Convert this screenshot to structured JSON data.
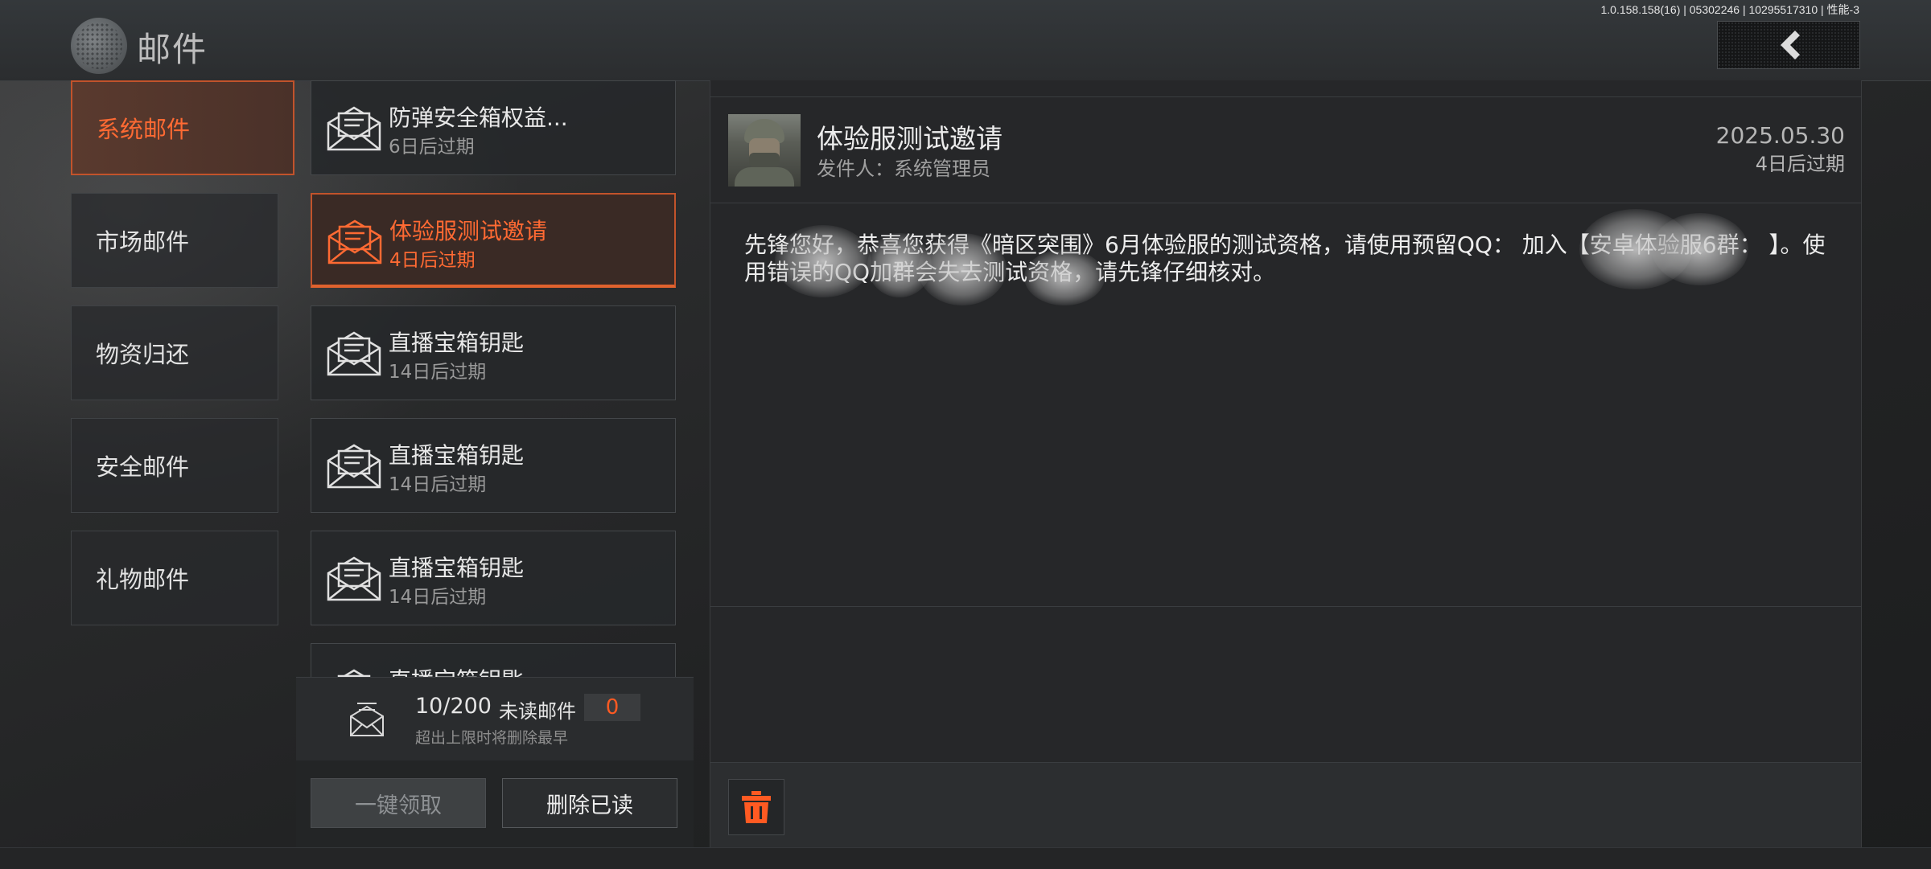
{
  "header": {
    "version": "1.0.158.158(16) | 05302246 | 10295517310 | 性能-3",
    "title": "邮件"
  },
  "categories": [
    {
      "label": "系统邮件",
      "active": true
    },
    {
      "label": "市场邮件",
      "active": false
    },
    {
      "label": "物资归还",
      "active": false
    },
    {
      "label": "安全邮件",
      "active": false
    },
    {
      "label": "礼物邮件",
      "active": false
    }
  ],
  "mails": [
    {
      "subject": "防弹安全箱权益...",
      "expiry": "6日后过期",
      "active": false
    },
    {
      "subject": "体验服测试邀请",
      "expiry": "4日后过期",
      "active": true
    },
    {
      "subject": "直播宝箱钥匙",
      "expiry": "14日后过期",
      "active": false
    },
    {
      "subject": "直播宝箱钥匙",
      "expiry": "14日后过期",
      "active": false
    },
    {
      "subject": "直播宝箱钥匙",
      "expiry": "14日后过期",
      "active": false
    },
    {
      "subject": "直播宝箱钥匙",
      "expiry": "",
      "active": false
    }
  ],
  "mailbox": {
    "count": "10/200",
    "unread_label": "未读邮件",
    "unread_count": "0",
    "note": "超出上限时将删除最早"
  },
  "actions": {
    "claim_all": "一键领取",
    "delete_read": "删除已读"
  },
  "detail": {
    "title": "体验服测试邀请",
    "sender": "发件人：系统管理员",
    "date": "2025.05.30",
    "expiry": "4日后过期",
    "body": "先锋您好，恭喜您获得《暗区突围》6月体验服的测试资格，请使用预留QQ：                    加入【安卓体验服6群：                    】。使用错误的QQ加群会失去测试资格，请先锋仔细核对。"
  },
  "colors": {
    "accent": "#ff6a33",
    "accent_border": "#c2532b",
    "unread_number": "#ff5a22"
  },
  "icons": {
    "back": "chevron-left-icon",
    "mail": "envelope-open-icon",
    "mail_stack": "mail-stack-icon",
    "delete": "trash-icon"
  }
}
